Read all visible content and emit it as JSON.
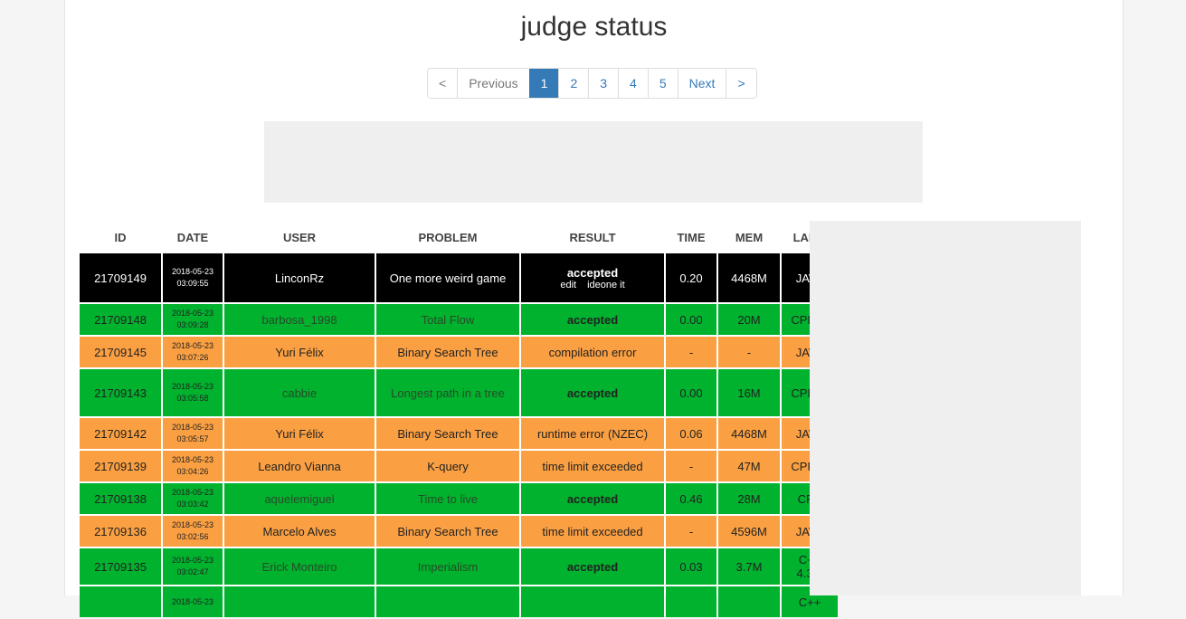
{
  "page_title": "judge status",
  "pagination": {
    "first": "<",
    "previous": "Previous",
    "pages": [
      "1",
      "2",
      "3",
      "4",
      "5"
    ],
    "active_page": "1",
    "next": "Next",
    "last": ">"
  },
  "table": {
    "headers": {
      "id": "ID",
      "date": "DATE",
      "user": "USER",
      "problem": "PROBLEM",
      "result": "RESULT",
      "time": "TIME",
      "mem": "MEM",
      "lang": "LANG"
    },
    "rows": [
      {
        "id": "21709149",
        "date": "2018-05-23",
        "time_of_day": "03:09:55",
        "user": "LinconRz",
        "problem": "One more weird game",
        "result": "accepted",
        "links": [
          "edit",
          "ideone it"
        ],
        "time": "0.20",
        "mem": "4468M",
        "lang": "JAVA",
        "status": "highlighted",
        "height": 54
      },
      {
        "id": "21709148",
        "date": "2018-05-23",
        "time_of_day": "03:09:28",
        "user": "barbosa_1998",
        "problem": "Total Flow",
        "result": "accepted",
        "time": "0.00",
        "mem": "20M",
        "lang": "CPP14",
        "status": "accepted",
        "height": 34
      },
      {
        "id": "21709145",
        "date": "2018-05-23",
        "time_of_day": "03:07:26",
        "user": "Yuri Félix",
        "problem": "Binary Search Tree",
        "result": "compilation error",
        "time": "-",
        "mem": "-",
        "lang": "JAVA",
        "status": "error",
        "height": 34
      },
      {
        "id": "21709143",
        "date": "2018-05-23",
        "time_of_day": "03:05:58",
        "user": "cabbie",
        "problem": "Longest path in a tree",
        "result": "accepted",
        "time": "0.00",
        "mem": "16M",
        "lang": "CPP14",
        "status": "accepted",
        "height": 52
      },
      {
        "id": "21709142",
        "date": "2018-05-23",
        "time_of_day": "03:05:57",
        "user": "Yuri Félix",
        "problem": "Binary Search Tree",
        "result": "runtime error (NZEC)",
        "time": "0.06",
        "mem": "4468M",
        "lang": "JAVA",
        "status": "error",
        "height": 34
      },
      {
        "id": "21709139",
        "date": "2018-05-23",
        "time_of_day": "03:04:26",
        "user": "Leandro Vianna",
        "problem": "K-query",
        "result": "time limit exceeded",
        "time": "-",
        "mem": "47M",
        "lang": "CPP14",
        "status": "error",
        "height": 34
      },
      {
        "id": "21709138",
        "date": "2018-05-23",
        "time_of_day": "03:03:42",
        "user": "aquelemiguel",
        "problem": "Time to live",
        "result": "accepted",
        "time": "0.46",
        "mem": "28M",
        "lang": "CPP",
        "status": "accepted",
        "height": 34
      },
      {
        "id": "21709136",
        "date": "2018-05-23",
        "time_of_day": "03:02:56",
        "user": "Marcelo Alves",
        "problem": "Binary Search Tree",
        "result": "time limit exceeded",
        "time": "-",
        "mem": "4596M",
        "lang": "JAVA",
        "status": "error",
        "height": 34
      },
      {
        "id": "21709135",
        "date": "2018-05-23",
        "time_of_day": "03:02:47",
        "user": "Erick Monteiro",
        "problem": "Imperialism",
        "result": "accepted",
        "time": "0.03",
        "mem": "3.7M",
        "lang": "C++ 4.3.2",
        "status": "accepted",
        "height": 40
      },
      {
        "id": "",
        "date": "2018-05-23",
        "time_of_day": "",
        "user": "",
        "problem": "",
        "result": "",
        "time": "",
        "mem": "",
        "lang": "C++",
        "status": "accepted",
        "height": 34
      }
    ]
  },
  "colors": {
    "accepted": "#00b22d",
    "error": "#fba042",
    "highlighted": "#000000",
    "pagination_active": "#337ab7"
  }
}
